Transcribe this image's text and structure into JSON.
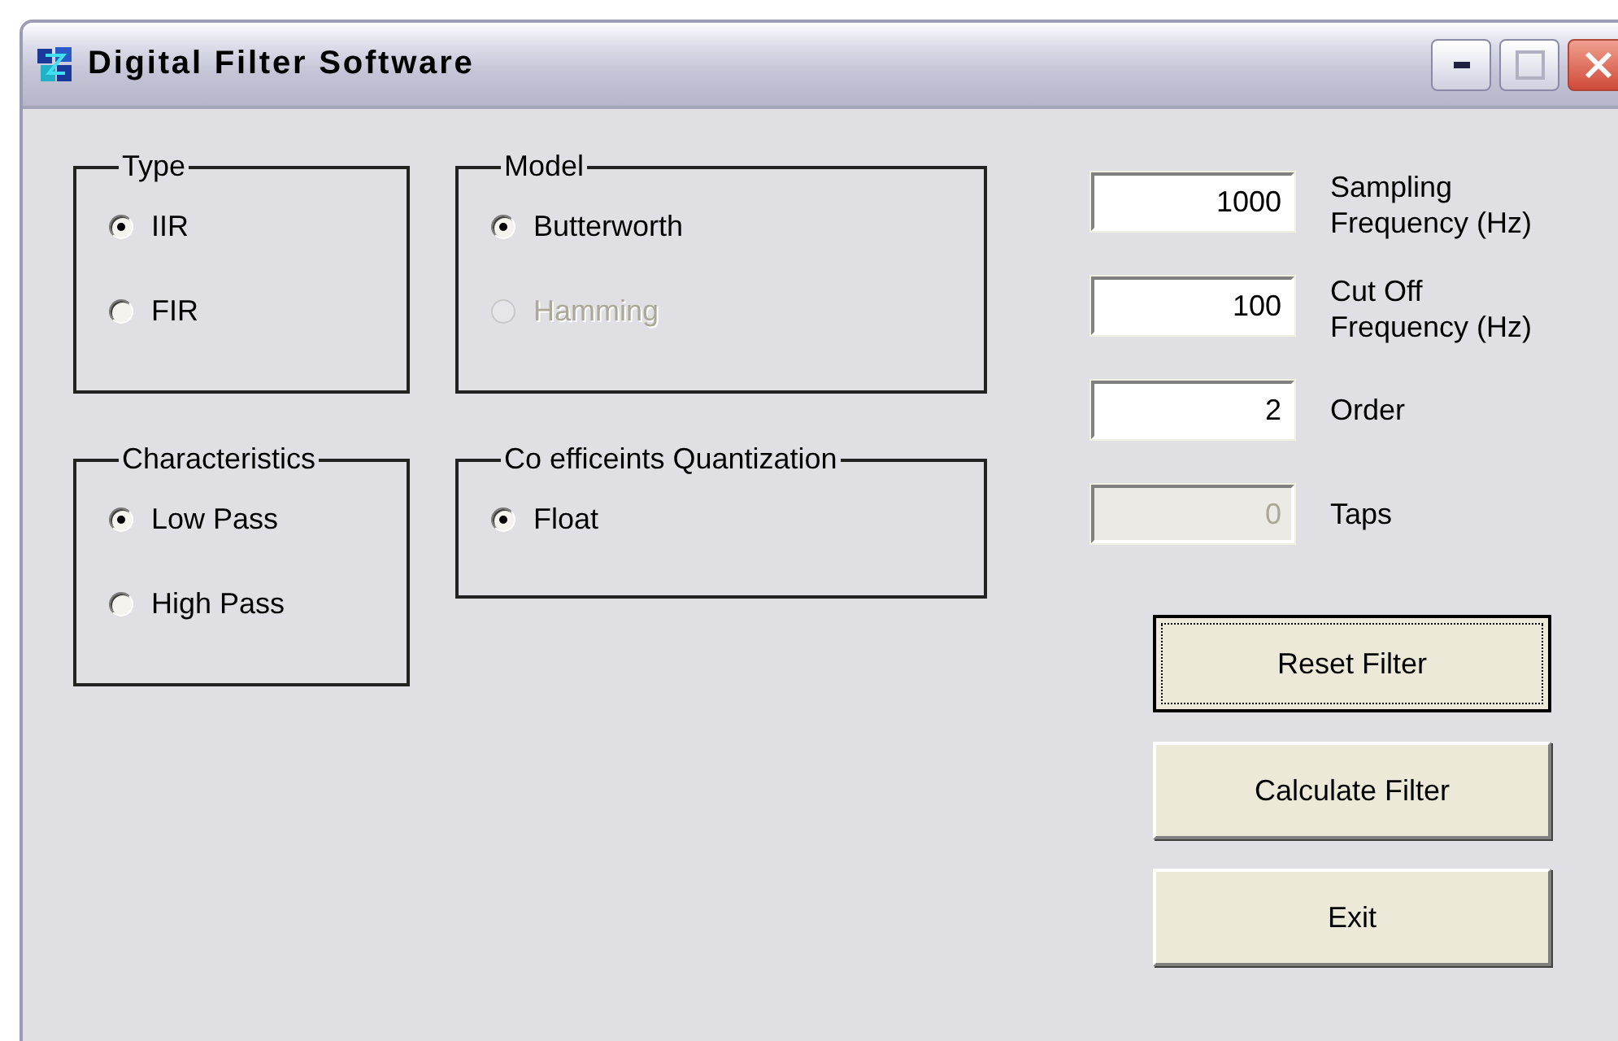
{
  "window": {
    "title": "Digital Filter Software"
  },
  "groups": [
    {
      "title": "Type",
      "options": [
        {
          "label": "IIR",
          "selected": true,
          "disabled": false
        },
        {
          "label": "FIR",
          "selected": false,
          "disabled": false
        }
      ]
    },
    {
      "title": "Model",
      "options": [
        {
          "label": "Butterworth",
          "selected": true,
          "disabled": false
        },
        {
          "label": "Hamming",
          "selected": false,
          "disabled": true
        }
      ]
    },
    {
      "title": "Characteristics",
      "options": [
        {
          "label": "Low Pass",
          "selected": true,
          "disabled": false
        },
        {
          "label": "High Pass",
          "selected": false,
          "disabled": false
        }
      ]
    },
    {
      "title": "Co efficeints Quantization",
      "options": [
        {
          "label": "Float",
          "selected": true,
          "disabled": false
        }
      ]
    }
  ],
  "fields": [
    {
      "label": "Sampling Frequency (Hz)",
      "value": "1000",
      "disabled": false
    },
    {
      "label": "Cut Off Frequency (Hz)",
      "value": "100",
      "disabled": false
    },
    {
      "label": "Order",
      "value": "2",
      "disabled": false
    },
    {
      "label": "Taps",
      "value": "0",
      "disabled": true
    }
  ],
  "buttons": [
    {
      "label": "Reset Filter",
      "focused": true
    },
    {
      "label": "Calculate Filter",
      "focused": false
    },
    {
      "label": "Exit",
      "focused": false
    }
  ]
}
